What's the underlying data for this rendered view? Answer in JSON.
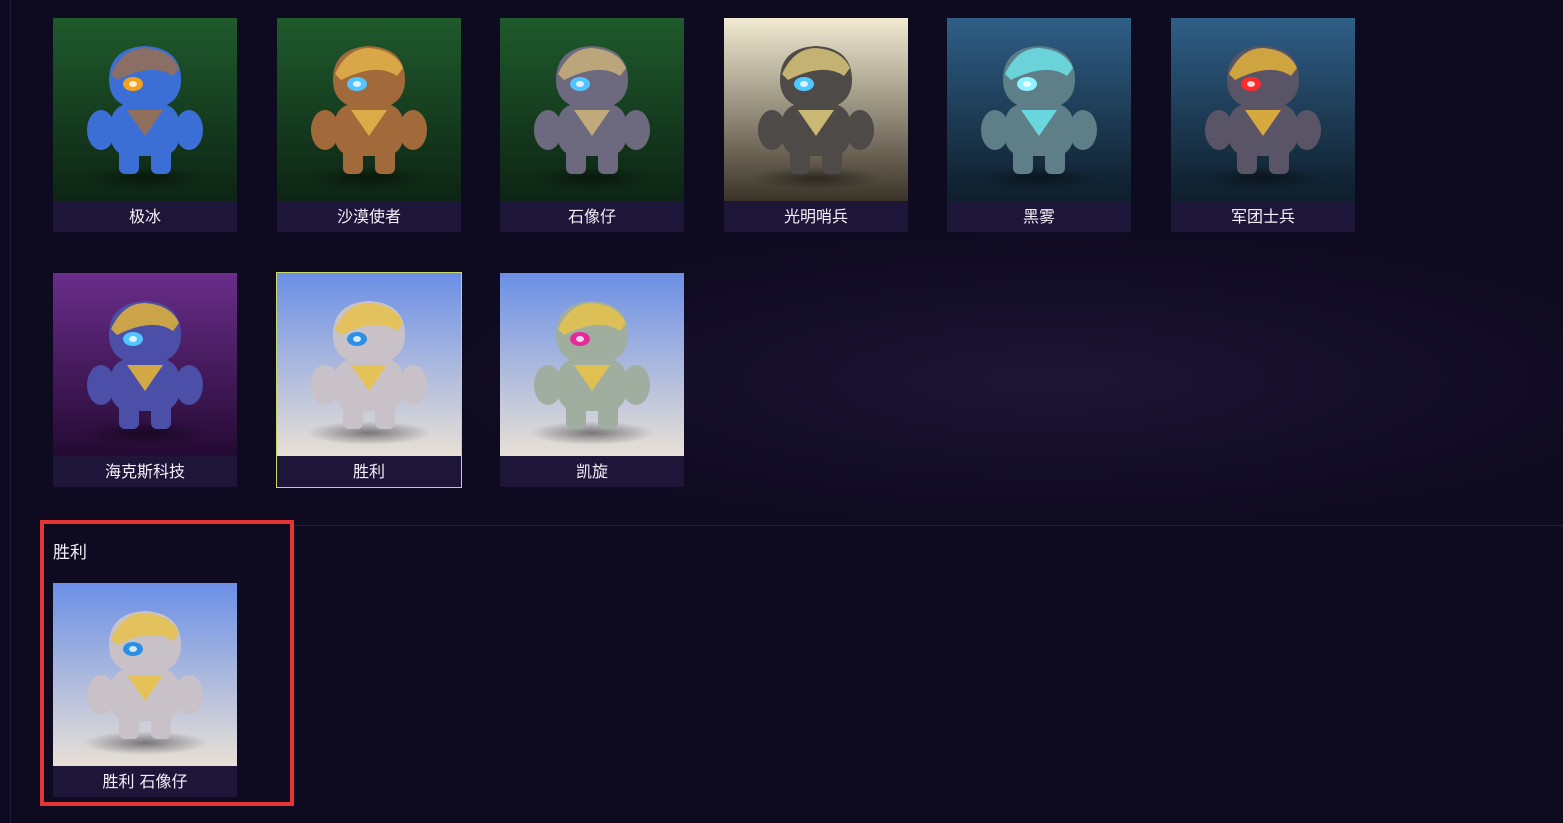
{
  "grid": {
    "items": [
      {
        "label": "极冰",
        "bg_top": "#1f5a2c",
        "bg_bottom": "#0d2414",
        "body": "#3b6fd6",
        "accent": "#9a7050",
        "eye": "#f2a31b",
        "selected": false
      },
      {
        "label": "沙漠使者",
        "bg_top": "#1f5a2c",
        "bg_bottom": "#0d2414",
        "body": "#a26a3a",
        "accent": "#e2b24a",
        "eye": "#52c4ff",
        "selected": false
      },
      {
        "label": "石像仔",
        "bg_top": "#1f5a2c",
        "bg_bottom": "#0d2414",
        "body": "#6d6a80",
        "accent": "#c9b07a",
        "eye": "#52c4ff",
        "selected": false
      },
      {
        "label": "光明哨兵",
        "bg_top": "#f2ead2",
        "bg_bottom": "#3a3428",
        "body": "#4d4a48",
        "accent": "#d8c47a",
        "eye": "#4fc8ff",
        "selected": false
      },
      {
        "label": "黑雾",
        "bg_top": "#2f5e86",
        "bg_bottom": "#0e1d2a",
        "body": "#5e7f88",
        "accent": "#6ce0e8",
        "eye": "#8ef3ff",
        "selected": false
      },
      {
        "label": "军团士兵",
        "bg_top": "#2f5e86",
        "bg_bottom": "#0e1d2a",
        "body": "#5a5566",
        "accent": "#e2b33a",
        "eye": "#ff2b2b",
        "selected": false
      },
      {
        "label": "海克斯科技",
        "bg_top": "#6a2d8a",
        "bg_bottom": "#240a33",
        "body": "#4b4fa8",
        "accent": "#e2b33a",
        "eye": "#52c4ff",
        "selected": false
      },
      {
        "label": "胜利",
        "bg_top": "#6b8fe6",
        "bg_bottom": "#e8e0d6",
        "body": "#c8c2c8",
        "accent": "#e8c24a",
        "eye": "#2a8fe6",
        "selected": true
      },
      {
        "label": "凯旋",
        "bg_top": "#6b8fe6",
        "bg_bottom": "#e8e0d6",
        "body": "#9fae9f",
        "accent": "#e8c24a",
        "eye": "#e62a9a",
        "selected": false
      }
    ]
  },
  "selection": {
    "title": "胜利",
    "result": {
      "label": "胜利 石像仔",
      "bg_top": "#6b8fe6",
      "bg_bottom": "#e8e0d6",
      "body": "#c8c2c8",
      "accent": "#e8c24a",
      "eye": "#2a8fe6"
    }
  },
  "colors": {
    "background": "#0e0a1f",
    "label_bar": "#1e1639",
    "selected_outline": "#c6d96a",
    "highlight_box": "#e53434"
  }
}
